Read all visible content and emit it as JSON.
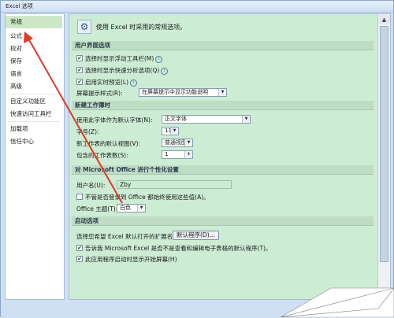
{
  "window": {
    "title": "Excel 选项"
  },
  "sidebar": {
    "items": [
      {
        "label": "常规",
        "selected": true
      },
      {
        "label": "公式"
      },
      {
        "label": "校对"
      },
      {
        "label": "保存"
      },
      {
        "label": "语言"
      },
      {
        "label": "高级"
      },
      {
        "label": "自定义功能区"
      },
      {
        "label": "快速访问工具栏"
      },
      {
        "label": "加载项"
      },
      {
        "label": "信任中心"
      }
    ]
  },
  "main": {
    "header": "使用 Excel 时采用的常规选项。",
    "ui_section": {
      "title": "用户界面选项",
      "mini_toolbar": "选择时显示浮动工具栏(M)",
      "quick_analysis": "选择时显示快速分析选项(Q)",
      "live_preview": "启用实时预览(L)",
      "screentip_label": "屏幕提示样式(R):",
      "screentip_value": "在屏幕提示中显示功能说明"
    },
    "workbook_section": {
      "title": "新建工作簿时",
      "font_label": "使用此字体作为默认字体(N):",
      "font_value": "正文字体",
      "size_label": "字号(Z):",
      "size_value": "11",
      "view_label": "新工作表的默认视图(V):",
      "view_value": "普通视图",
      "sheets_label": "包含的工作表数(S):",
      "sheets_value": "1"
    },
    "personalize_section": {
      "title": "对 Microsoft Office 进行个性化设置",
      "username_label": "用户名(U):",
      "username_value": "Zby",
      "always_use_label": "不管是否登录到 Office 都始终使用这些值(A)。",
      "theme_label": "Office 主题(T):",
      "theme_value": "白色"
    },
    "startup_section": {
      "title": "启动选项",
      "ext_label": "选择您希望 Excel 默认打开的扩展名:",
      "default_programs_button": "默认程序(D)...",
      "tell_me_label": "告诉我 Microsoft Excel 是否不是查看和编辑电子表格的默认程序(T)。",
      "show_start_label": "此应用程序启动时显示开始屏幕(H)"
    }
  },
  "annotation": {
    "arrow_color": "#e03a2a"
  }
}
